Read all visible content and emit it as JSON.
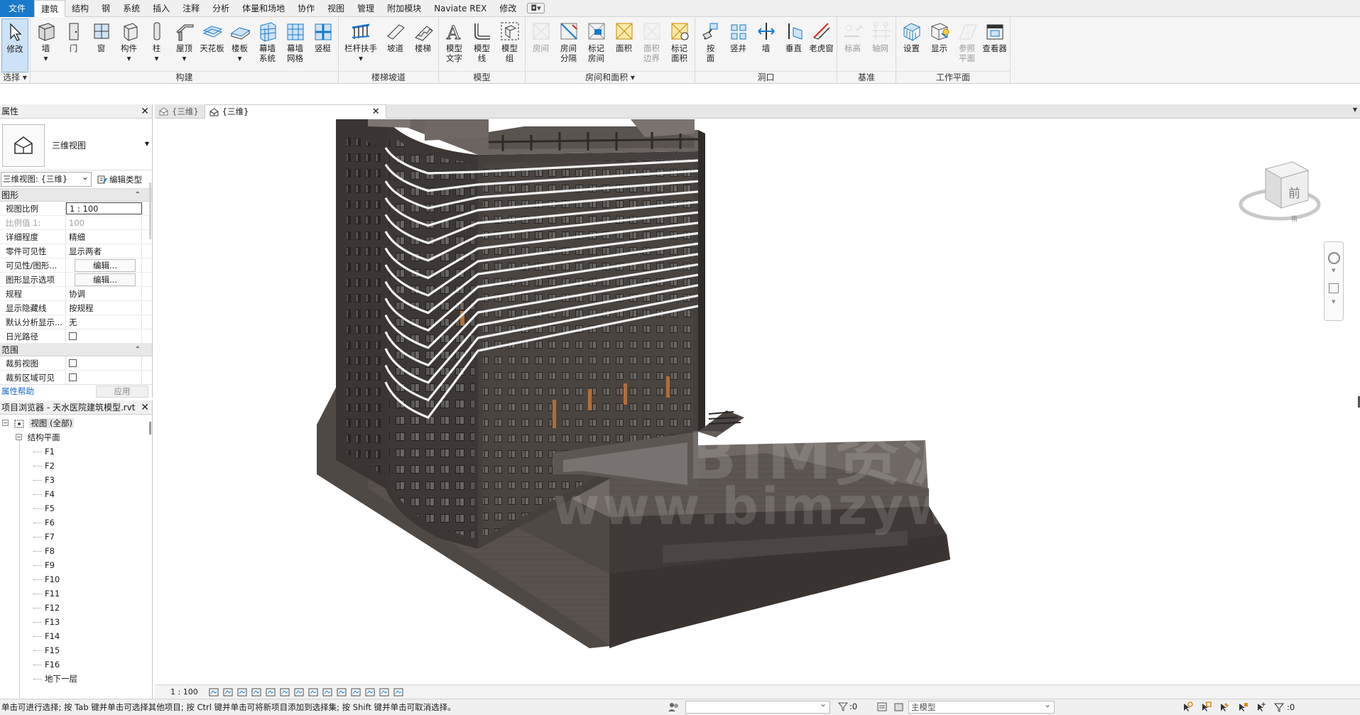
{
  "menu": {
    "items": [
      "文件",
      "建筑",
      "结构",
      "钢",
      "系统",
      "插入",
      "注释",
      "分析",
      "体量和场地",
      "协作",
      "视图",
      "管理",
      "附加模块",
      "Naviate REX",
      "修改"
    ],
    "active_index": 1,
    "extra": "◘▾"
  },
  "ribbon": {
    "groups": [
      {
        "title": "选择 ▾",
        "buttons": [
          {
            "label": "修改",
            "icon": "cursor-icon",
            "selected": true
          }
        ]
      },
      {
        "title": "构建",
        "buttons": [
          {
            "label": "墙\n▾",
            "icon": "wall-icon"
          },
          {
            "label": "门",
            "icon": "door-icon"
          },
          {
            "label": "窗",
            "icon": "window-icon"
          },
          {
            "label": "构件\n▾",
            "icon": "component-icon"
          },
          {
            "label": "柱\n▾",
            "icon": "column-icon"
          },
          {
            "label": "屋顶\n▾",
            "icon": "roof-icon"
          },
          {
            "label": "天花板",
            "icon": "ceiling-icon"
          },
          {
            "label": "楼板\n▾",
            "icon": "floor-icon"
          },
          {
            "label": "幕墙\n系统",
            "icon": "curtain-system-icon"
          },
          {
            "label": "幕墙\n网格",
            "icon": "curtain-grid-icon"
          },
          {
            "label": "竖梃",
            "icon": "mullion-icon"
          }
        ]
      },
      {
        "title": "楼梯坡道",
        "buttons": [
          {
            "label": "栏杆扶手\n▾",
            "icon": "railing-icon",
            "wide": true
          },
          {
            "label": "坡道",
            "icon": "ramp-icon"
          },
          {
            "label": "楼梯",
            "icon": "stair-icon"
          }
        ]
      },
      {
        "title": "模型",
        "buttons": [
          {
            "label": "模型\n文字",
            "icon": "model-text-icon"
          },
          {
            "label": "模型\n线",
            "icon": "model-line-icon"
          },
          {
            "label": "模型\n组",
            "icon": "model-group-icon"
          }
        ]
      },
      {
        "title": "房间和面积 ▾",
        "buttons": [
          {
            "label": "房间",
            "icon": "room-icon",
            "dim": true
          },
          {
            "label": "房间\n分隔",
            "icon": "room-separator-icon"
          },
          {
            "label": "标记\n房间",
            "icon": "tag-room-icon"
          },
          {
            "label": "面积",
            "icon": "area-icon"
          },
          {
            "label": "面积\n边界",
            "icon": "area-boundary-icon",
            "dim": true
          },
          {
            "label": "标记\n面积",
            "icon": "tag-area-icon"
          }
        ]
      },
      {
        "title": "洞口",
        "buttons": [
          {
            "label": "按\n面",
            "icon": "by-face-icon"
          },
          {
            "label": "竖井",
            "icon": "shaft-icon"
          },
          {
            "label": "墙",
            "icon": "wall-opening-icon"
          },
          {
            "label": "垂直",
            "icon": "vertical-icon"
          },
          {
            "label": "老虎窗",
            "icon": "dormer-icon"
          }
        ]
      },
      {
        "title": "基准",
        "buttons": [
          {
            "label": "标高",
            "icon": "level-icon",
            "dim": true
          },
          {
            "label": "轴网",
            "icon": "grid-icon",
            "dim": true
          }
        ]
      },
      {
        "title": "工作平面",
        "buttons": [
          {
            "label": "设置",
            "icon": "set-icon"
          },
          {
            "label": "显示",
            "icon": "show-icon"
          },
          {
            "label": "参照\n平面",
            "icon": "ref-plane-icon",
            "dim": true
          },
          {
            "label": "查看器",
            "icon": "viewer-icon"
          }
        ]
      }
    ]
  },
  "properties": {
    "title": "属性",
    "type_name": "三维视图",
    "view_selector": "三维视图: {三维}",
    "edit_type": "编辑类型",
    "sections": [
      {
        "title": "图形",
        "rows": [
          {
            "name": "视图比例",
            "value": "1 : 100",
            "kind": "boxed"
          },
          {
            "name": "比例值 1:",
            "value": "100",
            "dim": true
          },
          {
            "name": "详细程度",
            "value": "精细"
          },
          {
            "name": "零件可见性",
            "value": "显示两者"
          },
          {
            "name": "可见性/图形...",
            "value": "编辑...",
            "kind": "btn"
          },
          {
            "name": "图形显示选项",
            "value": "编辑...",
            "kind": "btn"
          },
          {
            "name": "规程",
            "value": "协调"
          },
          {
            "name": "显示隐藏线",
            "value": "按规程"
          },
          {
            "name": "默认分析显示...",
            "value": "无"
          },
          {
            "name": "日光路径",
            "value": "",
            "kind": "check"
          }
        ]
      },
      {
        "title": "范围",
        "rows": [
          {
            "name": "裁剪视图",
            "value": "",
            "kind": "check"
          },
          {
            "name": "裁剪区域可见",
            "value": "",
            "kind": "check"
          }
        ]
      }
    ],
    "help_link": "属性帮助",
    "apply_label": "应用"
  },
  "browser": {
    "title": "项目浏览器 - 天水医院建筑模型.rvt",
    "root": "视图 (全部)",
    "folder": "结构平面",
    "levels": [
      "F1",
      "F2",
      "F3",
      "F4",
      "F5",
      "F6",
      "F7",
      "F8",
      "F9",
      "F10",
      "F11",
      "F12",
      "F13",
      "F14",
      "F15",
      "F16",
      "地下一层"
    ]
  },
  "doc_tabs": [
    {
      "label": "{三维}",
      "active": false
    },
    {
      "label": "{三维}",
      "active": true
    }
  ],
  "viewport": {
    "watermark_line1": "BIM资源网",
    "watermark_line2": "www.bimzyw.com",
    "viewcube_face": "前",
    "viewcube_compass_label": "南"
  },
  "view_bar": {
    "scale": "1 : 100"
  },
  "status": {
    "message": "单击可进行选择; 按 Tab 键并单击可选择其他项目; 按 Ctrl 键并单击可将新项目添加到选择集; 按 Shift 键并单击可取消选择。",
    "filter_count": ":0",
    "model": "主模型",
    "selection_count": ":0"
  },
  "colors": {
    "accent": "#1979ca",
    "building_dark": "#3e3937",
    "building_mid": "#5b5552",
    "building_light": "#766f6a"
  }
}
